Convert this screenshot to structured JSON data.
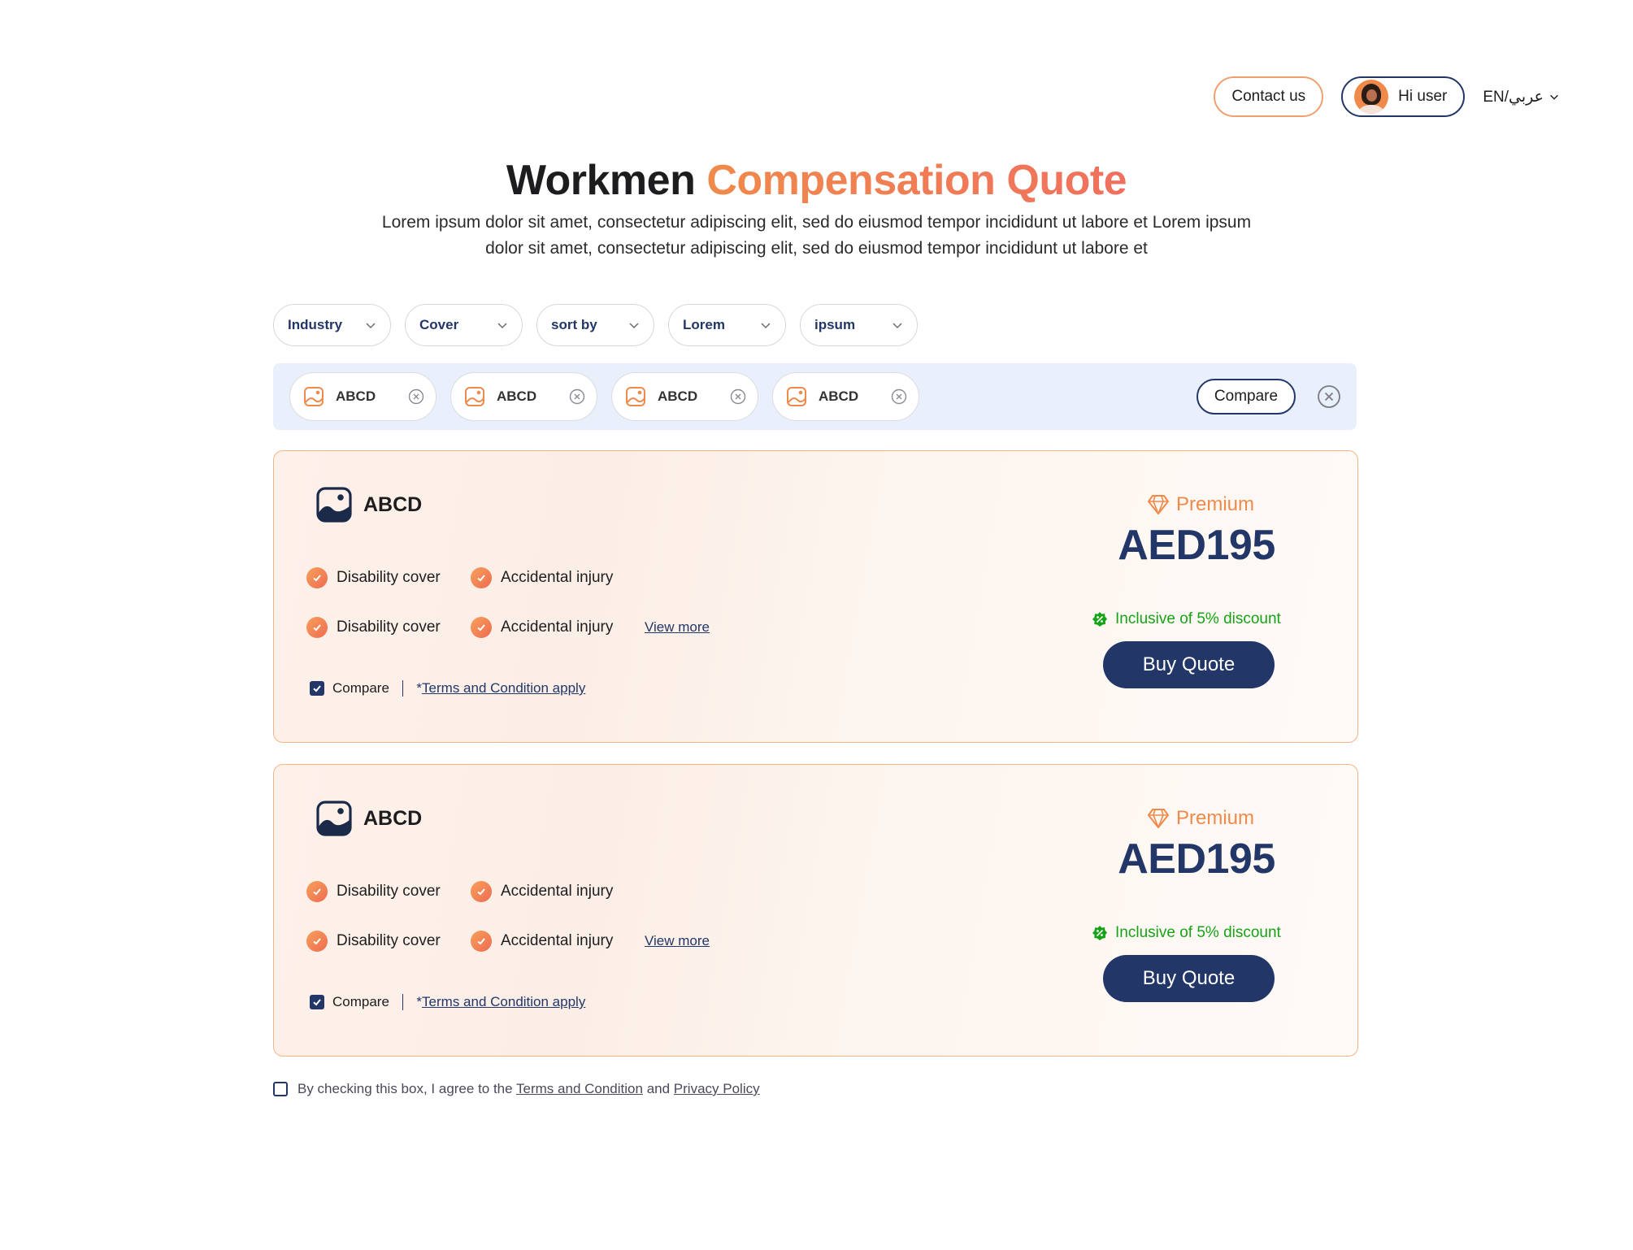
{
  "header": {
    "contact_label": "Contact us",
    "user_label": "Hi user",
    "language_label": "EN/عربي"
  },
  "hero": {
    "title_part1": "Workmen",
    "title_part2": "Compensation Quote",
    "subtitle_line1": "Lorem ipsum dolor sit amet, consectetur adipiscing elit, sed do eiusmod tempor incididunt ut labore et Lorem ipsum",
    "subtitle_line2": "dolor sit amet, consectetur adipiscing elit, sed do eiusmod tempor incididunt ut labore et"
  },
  "filters": [
    "Industry",
    "Cover",
    "sort by",
    "Lorem",
    "ipsum"
  ],
  "compare_bar": {
    "chips": [
      "ABCD",
      "ABCD",
      "ABCD",
      "ABCD"
    ],
    "compare_label": "Compare"
  },
  "quotes": [
    {
      "provider": "ABCD",
      "features": [
        [
          "Disability cover",
          "Accidental injury"
        ],
        [
          "Disability cover",
          "Accidental injury"
        ]
      ],
      "view_more": "View more",
      "compare_label": "Compare",
      "compare_checked": true,
      "terms_star": "*",
      "terms_label": "Terms and Condition apply",
      "premium_label": "Premium",
      "price": "AED195",
      "discount": "Inclusive of 5% discount",
      "buy_label": "Buy Quote"
    },
    {
      "provider": "ABCD",
      "features": [
        [
          "Disability cover",
          "Accidental injury"
        ],
        [
          "Disability cover",
          "Accidental injury"
        ]
      ],
      "view_more": "View more",
      "compare_label": "Compare",
      "compare_checked": true,
      "terms_star": "*",
      "terms_label": "Terms and Condition apply",
      "premium_label": "Premium",
      "price": "AED195",
      "discount": "Inclusive of 5% discount",
      "buy_label": "Buy Quote"
    }
  ],
  "agreement": {
    "prefix": "By checking this box, I agree to the",
    "terms_link": "Terms and Condition",
    "and": "and",
    "privacy_link": "Privacy Policy",
    "checked": false
  },
  "colors": {
    "navy": "#223768",
    "accent_orange": "#f08a4b",
    "discount_green": "#17a317",
    "compare_bar_bg": "#e9f0fc"
  }
}
